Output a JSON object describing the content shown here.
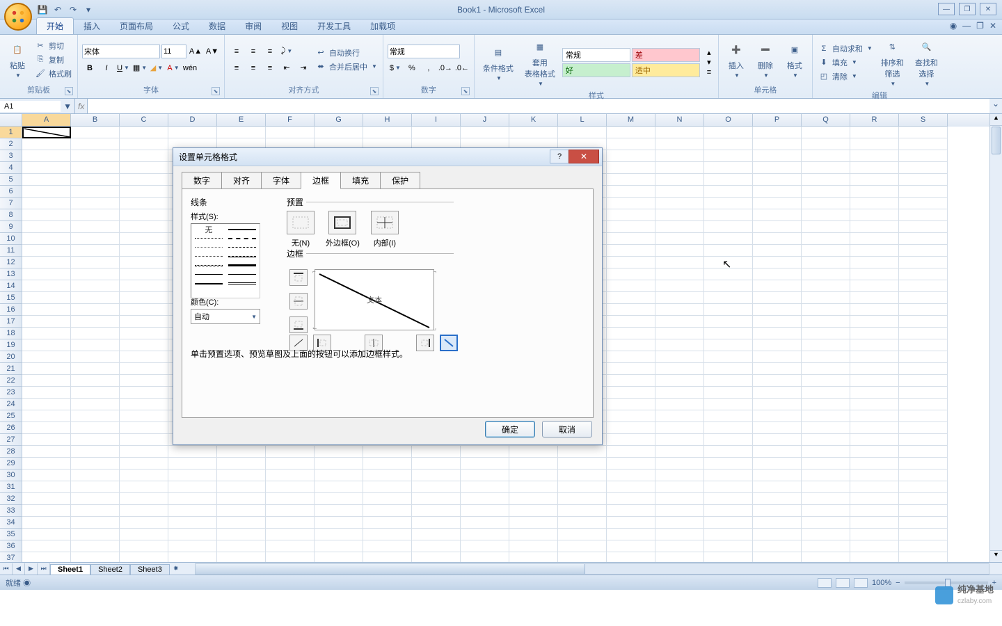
{
  "app": {
    "title": "Book1 - Microsoft Excel"
  },
  "tabs": {
    "t0": "开始",
    "t1": "插入",
    "t2": "页面布局",
    "t3": "公式",
    "t4": "数据",
    "t5": "审阅",
    "t6": "视图",
    "t7": "开发工具",
    "t8": "加载项"
  },
  "clipboard": {
    "paste": "粘贴",
    "cut": "剪切",
    "copy": "复制",
    "painter": "格式刷",
    "label": "剪贴板"
  },
  "font": {
    "name": "宋体",
    "size": "11",
    "label": "字体"
  },
  "align": {
    "wrap": "自动换行",
    "merge": "合并后居中",
    "label": "对齐方式"
  },
  "number": {
    "format": "常规",
    "label": "数字"
  },
  "styles": {
    "cond": "条件格式",
    "table": "套用\n表格格式",
    "normal": "常规",
    "bad": "差",
    "good": "好",
    "neutral": "适中",
    "label": "样式"
  },
  "cells": {
    "insert": "插入",
    "delete": "删除",
    "format": "格式",
    "label": "单元格"
  },
  "editing": {
    "sum": "自动求和",
    "fill": "填充",
    "clear": "清除",
    "sort": "排序和\n筛选",
    "find": "查找和\n选择",
    "label": "编辑"
  },
  "namebox": "A1",
  "columns": [
    "A",
    "B",
    "C",
    "D",
    "E",
    "F",
    "G",
    "H",
    "I",
    "J",
    "K",
    "L",
    "M",
    "N",
    "O",
    "P",
    "Q",
    "R",
    "S"
  ],
  "rows_count": 37,
  "sheets": {
    "s1": "Sheet1",
    "s2": "Sheet2",
    "s3": "Sheet3"
  },
  "status": {
    "ready": "就绪",
    "zoom": "100%"
  },
  "dialog": {
    "title": "设置单元格格式",
    "tabs": {
      "number": "数字",
      "align": "对齐",
      "font": "字体",
      "border": "边框",
      "fill": "填充",
      "protect": "保护"
    },
    "line": "线条",
    "style": "样式(S):",
    "none": "无",
    "color": "颜色(C):",
    "auto": "自动",
    "presets": "预置",
    "p_none": "无(N)",
    "p_outline": "外边框(O)",
    "p_inside": "内部(I)",
    "border": "边框",
    "preview_text": "文本",
    "hint": "单击预置选项、预览草图及上面的按钮可以添加边框样式。",
    "ok": "确定",
    "cancel": "取消"
  },
  "watermark": {
    "name": "纯净基地",
    "url": "czlaby.com"
  }
}
